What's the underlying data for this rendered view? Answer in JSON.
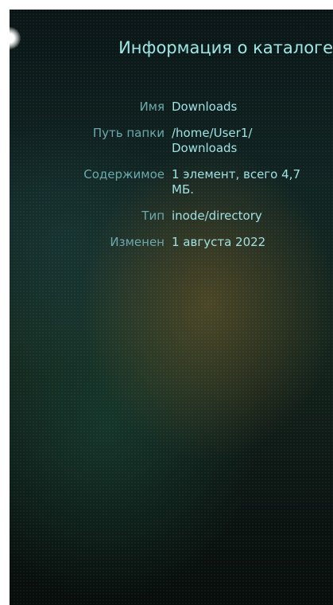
{
  "header": {
    "title": "Информация о каталоге"
  },
  "details": [
    {
      "label": "Имя",
      "value": "Downloads"
    },
    {
      "label": "Путь папки",
      "value": "/home/User1/\nDownloads"
    },
    {
      "label": "Содержимое",
      "value": "1 элемент, всего 4,7\nМБ."
    },
    {
      "label": "Тип",
      "value": "inode/directory"
    },
    {
      "label": "Изменен",
      "value": "1 августа 2022"
    }
  ],
  "colors": {
    "title": "#9fe6e6",
    "label": "#6aa8ab",
    "value": "#9fe0e2",
    "background": "#102422"
  }
}
